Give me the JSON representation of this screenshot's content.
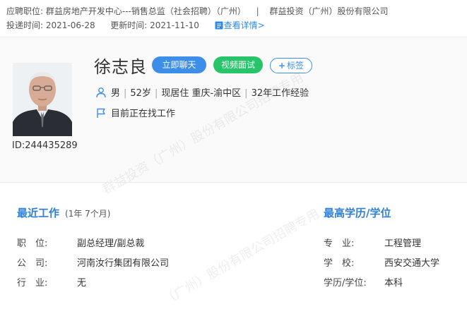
{
  "apply": {
    "position_label": "应聘职位:",
    "position_value": "群益房地产开发中心---销售总监（社会招聘）（广州）",
    "separator": "|",
    "company": "群益投资（广州）股份有限公司",
    "submit_label": "投递时间:",
    "submit_date": "2021-06-28",
    "update_label": "更新时间:",
    "update_date": "2021-11-10",
    "detail_link": "查看详情>"
  },
  "candidate": {
    "name": "徐志良",
    "chat_button": "立即聊天",
    "video_button": "视频面试",
    "tag_button": "标签",
    "gender": "男",
    "age": "52岁",
    "residence": "现居住 重庆-渝中区",
    "experience": "32年工作经验",
    "job_status": "目前正在找工作",
    "id_text": "ID:244435289",
    "divider": "|"
  },
  "watermark": {
    "text1": "群益投资（广州）股份有限公司招聘专用",
    "text2": "（广州）股份有限公司招聘专用"
  },
  "recent_work": {
    "title": "最近工作",
    "duration": "(1年 7个月)",
    "rows": [
      {
        "label": "职　位:",
        "value": "副总经理/副总裁"
      },
      {
        "label": "公　司:",
        "value": "河南汝行集团有限公司"
      },
      {
        "label": "行　业:",
        "value": "无"
      }
    ]
  },
  "education": {
    "title": "最高学历/学位",
    "rows": [
      {
        "label": "专　业:",
        "value": "工程管理"
      },
      {
        "label": "学　校:",
        "value": "西安交通大学"
      },
      {
        "label": "学历/学位:",
        "value": "本科"
      }
    ]
  },
  "colors": {
    "accent_blue": "#3d8ee8",
    "accent_green": "#27c46a",
    "section_title": "#2f7fd8"
  }
}
